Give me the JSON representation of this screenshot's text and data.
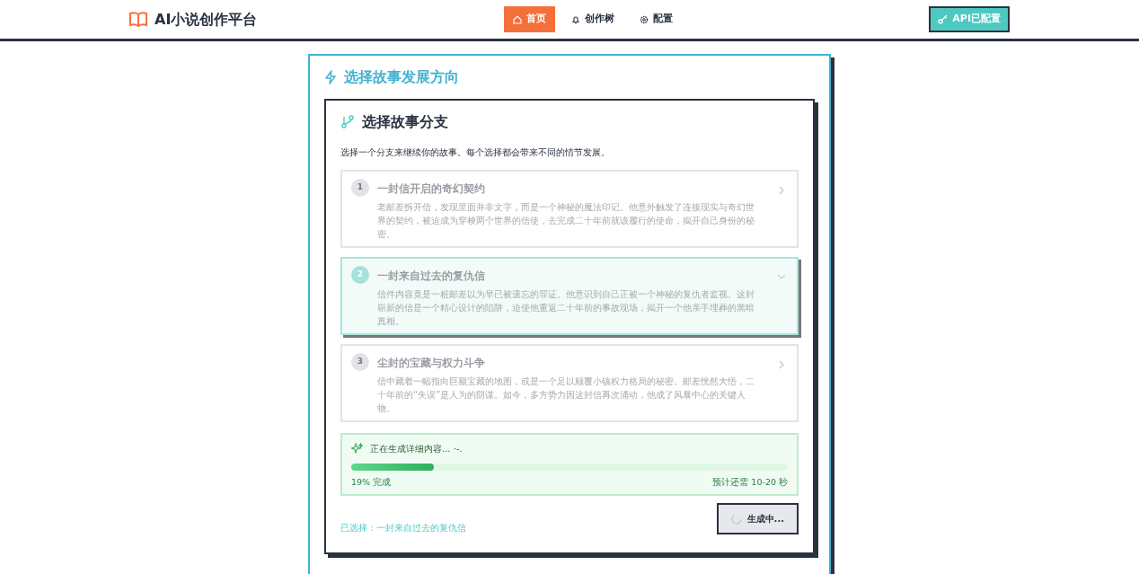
{
  "navbar": {
    "brand": "AI小说创作平台",
    "links": [
      {
        "label": "首页",
        "kind": "home",
        "selected": true
      },
      {
        "label": "创作树",
        "kind": "bell",
        "selected": false
      },
      {
        "label": "配置",
        "kind": "gear",
        "selected": false
      }
    ],
    "api_button": "API已配置"
  },
  "panel": {
    "title": "选择故事发展方向",
    "card": {
      "title": "选择故事分支",
      "intro": "选择一个分支来继续你的故事。每个选择都会带来不同的情节发展。",
      "options": [
        {
          "number": "1",
          "title": "一封信开启的奇幻契约",
          "description": "老邮差拆开信，发现里面并非文字，而是一个神秘的魔法印记。他意外触发了连接现实与奇幻世界的契约，被迫成为穿梭两个世界的信使，去完成二十年前就该履行的使命，揭开自己身份的秘密。",
          "selected": false
        },
        {
          "number": "2",
          "title": "一封来自过去的复仇信",
          "description": "信件内容竟是一桩邮差以为早已被遗忘的罪证。他意识到自己正被一个神秘的复仇者监视。这封崭新的信是一个精心设计的陷阱，迫使他重返二十年前的事故现场，揭开一个他亲手埋葬的黑暗真相。",
          "selected": true
        },
        {
          "number": "3",
          "title": "尘封的宝藏与权力斗争",
          "description": "信中藏着一幅指向巨额宝藏的地图，或是一个足以颠覆小镇权力格局的秘密。邮差恍然大悟，二十年前的“失误”是人为的阴谋。如今，多方势力因这封信再次涌动，他成了风暴中心的关键人物。",
          "selected": false
        }
      ],
      "progress": {
        "status": "正在生成详细内容... ·-.",
        "level": 0.19,
        "percent_label": "19% 完成",
        "eta": "预计还需 10-20 秒"
      },
      "selection": "已选择：一封来自过去的复仇信",
      "generate_button": {
        "label": "生成中...",
        "disabled": true
      }
    }
  }
}
